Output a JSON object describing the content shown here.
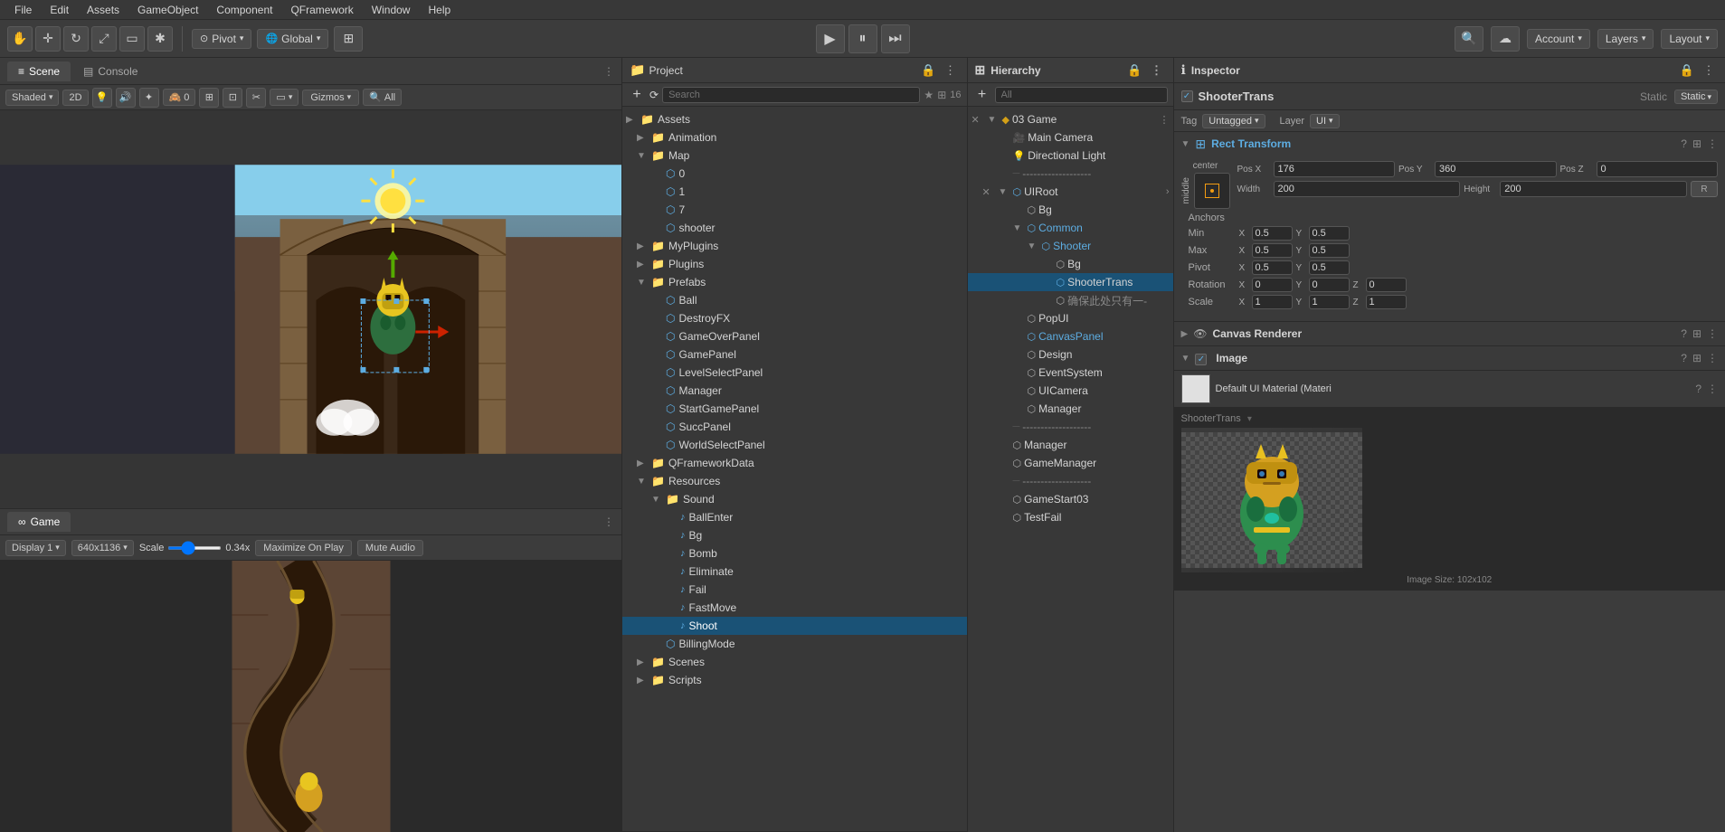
{
  "menu": {
    "items": [
      "File",
      "Edit",
      "Assets",
      "GameObject",
      "Component",
      "QFramework",
      "Window",
      "Help"
    ]
  },
  "toolbar": {
    "pivot_label": "Pivot",
    "global_label": "Global",
    "account_label": "Account",
    "layers_label": "Layers",
    "layout_label": "Layout"
  },
  "scene_panel": {
    "tab_scene": "Scene",
    "tab_console": "Console",
    "shaded_label": "Shaded",
    "two_d_label": "2D",
    "gizmos_label": "Gizmos",
    "all_label": "All"
  },
  "game_panel": {
    "label": "Game",
    "display_label": "Display 1",
    "resolution_label": "640x1136",
    "scale_label": "Scale",
    "scale_value": "0.34x",
    "maximize_label": "Maximize On Play",
    "mute_label": "Mute Audio"
  },
  "project_panel": {
    "title": "Project",
    "count": "16",
    "assets": {
      "label": "Assets",
      "children": [
        {
          "label": "Animation",
          "type": "folder",
          "indent": 1
        },
        {
          "label": "Map",
          "type": "folder",
          "indent": 1,
          "expanded": true
        },
        {
          "label": "0",
          "type": "prefab",
          "indent": 2
        },
        {
          "label": "1",
          "type": "prefab",
          "indent": 2
        },
        {
          "label": "7",
          "type": "prefab",
          "indent": 2
        },
        {
          "label": "shooter",
          "type": "prefab",
          "indent": 2
        },
        {
          "label": "MyPlugins",
          "type": "folder",
          "indent": 1
        },
        {
          "label": "Plugins",
          "type": "folder",
          "indent": 1
        },
        {
          "label": "Prefabs",
          "type": "folder",
          "indent": 1,
          "expanded": true
        },
        {
          "label": "Ball",
          "type": "prefab",
          "indent": 2
        },
        {
          "label": "DestroyFX",
          "type": "prefab",
          "indent": 2
        },
        {
          "label": "GameOverPanel",
          "type": "prefab",
          "indent": 2
        },
        {
          "label": "GamePanel",
          "type": "prefab",
          "indent": 2
        },
        {
          "label": "LevelSelectPanel",
          "type": "prefab",
          "indent": 2
        },
        {
          "label": "Manager",
          "type": "prefab",
          "indent": 2
        },
        {
          "label": "StartGamePanel",
          "type": "prefab",
          "indent": 2
        },
        {
          "label": "SuccPanel",
          "type": "prefab",
          "indent": 2
        },
        {
          "label": "WorldSelectPanel",
          "type": "prefab",
          "indent": 2
        },
        {
          "label": "QFrameworkData",
          "type": "folder",
          "indent": 1
        },
        {
          "label": "Resources",
          "type": "folder",
          "indent": 1,
          "expanded": true
        },
        {
          "label": "Sound",
          "type": "folder",
          "indent": 2,
          "expanded": true
        },
        {
          "label": "BallEnter",
          "type": "audio",
          "indent": 3
        },
        {
          "label": "Bg",
          "type": "audio",
          "indent": 3
        },
        {
          "label": "Bomb",
          "type": "audio",
          "indent": 3
        },
        {
          "label": "Eliminate",
          "type": "audio",
          "indent": 3
        },
        {
          "label": "Fail",
          "type": "audio",
          "indent": 3
        },
        {
          "label": "FastMove",
          "type": "audio",
          "indent": 3
        },
        {
          "label": "Shoot",
          "type": "audio",
          "indent": 3
        },
        {
          "label": "BillingMode",
          "type": "prefab",
          "indent": 2
        },
        {
          "label": "Scenes",
          "type": "folder",
          "indent": 1
        },
        {
          "label": "Scripts",
          "type": "folder",
          "indent": 1
        }
      ]
    }
  },
  "hierarchy_panel": {
    "title": "Hierarchy",
    "items": [
      {
        "label": "03 Game",
        "type": "scene",
        "indent": 0,
        "expanded": true,
        "has_arrow": true
      },
      {
        "label": "Main Camera",
        "type": "camera",
        "indent": 1
      },
      {
        "label": "Directional Light",
        "type": "light",
        "indent": 1
      },
      {
        "label": "-------------------",
        "type": "separator",
        "indent": 1
      },
      {
        "label": "UIRoot",
        "type": "uiroot",
        "indent": 1,
        "expanded": true,
        "has_arrow": true,
        "has_expand": true
      },
      {
        "label": "Bg",
        "type": "object",
        "indent": 2
      },
      {
        "label": "Common",
        "type": "object",
        "indent": 2,
        "expanded": true,
        "has_arrow": true,
        "color": "blue"
      },
      {
        "label": "Shooter",
        "type": "object",
        "indent": 3,
        "expanded": true,
        "has_arrow": true,
        "color": "blue"
      },
      {
        "label": "Bg",
        "type": "object",
        "indent": 4
      },
      {
        "label": "ShooterTrans",
        "type": "object",
        "indent": 4,
        "selected": true
      },
      {
        "label": "确保此处只有一-",
        "type": "object",
        "indent": 4,
        "color": "grey"
      },
      {
        "label": "PopUI",
        "type": "object",
        "indent": 2
      },
      {
        "label": "CanvasPanel",
        "type": "object",
        "indent": 2,
        "color": "blue"
      },
      {
        "label": "Design",
        "type": "object",
        "indent": 2
      },
      {
        "label": "EventSystem",
        "type": "object",
        "indent": 2
      },
      {
        "label": "UICamera",
        "type": "object",
        "indent": 2
      },
      {
        "label": "Manager",
        "type": "object",
        "indent": 2
      },
      {
        "label": "-------------------",
        "type": "separator",
        "indent": 1
      },
      {
        "label": "Manager",
        "type": "object",
        "indent": 1
      },
      {
        "label": "GameManager",
        "type": "object",
        "indent": 1
      },
      {
        "label": "-------------------",
        "type": "separator",
        "indent": 1
      },
      {
        "label": "GameStart03",
        "type": "object",
        "indent": 1
      },
      {
        "label": "TestFail",
        "type": "object",
        "indent": 1
      }
    ]
  },
  "inspector_panel": {
    "title": "Inspector",
    "object_name": "ShooterTrans",
    "static_label": "Static",
    "tag_label": "Tag",
    "tag_value": "Untagged",
    "layer_label": "Layer",
    "layer_value": "UI",
    "rect_transform": {
      "title": "Rect Transform",
      "center_label": "center",
      "middle_label": "middle",
      "pos_x_label": "Pos X",
      "pos_x_value": "176",
      "pos_y_label": "Pos Y",
      "pos_y_value": "360",
      "pos_z_label": "Pos Z",
      "pos_z_value": "0",
      "width_label": "Width",
      "width_value": "200",
      "height_label": "Height",
      "height_value": "200",
      "anchors_label": "Anchors",
      "min_label": "Min",
      "min_x": "0.5",
      "min_y": "0.5",
      "max_label": "Max",
      "max_x": "0.5",
      "max_y": "0.5",
      "pivot_label": "Pivot",
      "pivot_x": "0.5",
      "pivot_y": "0.5",
      "rotation_label": "Rotation",
      "rotation_x": "0",
      "rotation_y": "0",
      "rotation_z": "0",
      "scale_label": "Scale",
      "scale_x": "1",
      "scale_y": "1",
      "scale_z": "1"
    },
    "canvas_renderer": {
      "title": "Canvas Renderer"
    },
    "image": {
      "title": "Image"
    },
    "material_name": "Default UI Material (Materi",
    "preview_object": "ShooterTrans",
    "preview_size": "Image Size: 102x102"
  }
}
